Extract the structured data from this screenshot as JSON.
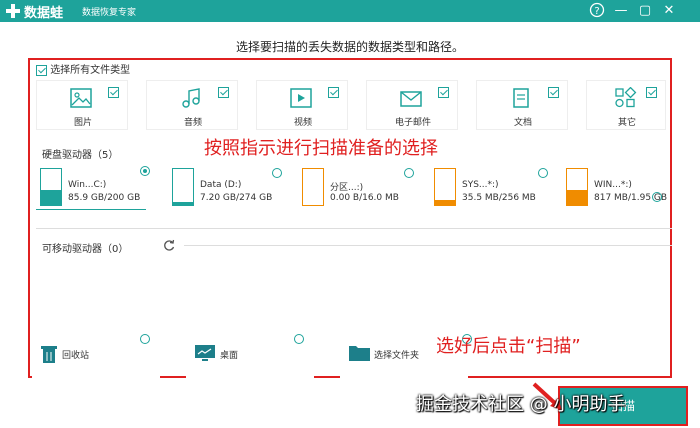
{
  "app": {
    "name": "数据蛙",
    "subtitle": "数据恢复专家",
    "window_controls": [
      "?",
      "—",
      "▢",
      "✕"
    ]
  },
  "instruction": "选择要扫描的丢失数据的数据类型和路径。",
  "select_all_label": "选择所有文件类型",
  "file_types": [
    {
      "label": "图片",
      "icon": "image-icon"
    },
    {
      "label": "音频",
      "icon": "music-icon"
    },
    {
      "label": "视频",
      "icon": "video-icon"
    },
    {
      "label": "电子邮件",
      "icon": "email-icon"
    },
    {
      "label": "文档",
      "icon": "document-icon"
    },
    {
      "label": "其它",
      "icon": "other-icon"
    }
  ],
  "annotations": {
    "top": "按照指示进行扫描准备的选择",
    "bottom": "选好后点击“扫描”"
  },
  "hard_drives": {
    "label": "硬盘驱动器（5）",
    "drives": [
      {
        "name": "Win...C:)",
        "size": "85.9 GB/200 GB",
        "fill": 0.43,
        "color": "#1ea39b",
        "selected": true
      },
      {
        "name": "Data (D:)",
        "size": "7.20 GB/274 GB",
        "fill": 0.03,
        "color": "#1ea39b",
        "selected": false
      },
      {
        "name": "分区...:)",
        "size": "0.00  B/16.0 MB",
        "fill": 0.0,
        "color": "#f08c00",
        "selected": false
      },
      {
        "name": "SYS...*:)",
        "size": "35.5 MB/256 MB",
        "fill": 0.14,
        "color": "#f08c00",
        "selected": false
      },
      {
        "name": "WIN...*:)",
        "size": "817 MB/1.95 GB",
        "fill": 0.42,
        "color": "#f08c00",
        "selected": false
      }
    ]
  },
  "removable_drives": {
    "label": "可移动驱动器（0）"
  },
  "locations": [
    {
      "label": "回收站",
      "icon": "recycle-bin-icon"
    },
    {
      "label": "桌面",
      "icon": "desktop-icon"
    },
    {
      "label": "选择文件夹",
      "icon": "folder-icon"
    }
  ],
  "scan_button": "扫描",
  "watermark": "掘金技术社区 @ 小明助手",
  "colors": {
    "accent": "#1ea39b",
    "annotation": "#e02020",
    "system_drive": "#f08c00"
  }
}
